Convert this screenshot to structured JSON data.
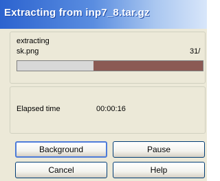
{
  "window": {
    "title": "Extracting from inp7_8.tar.gz"
  },
  "status": {
    "action": "extracting",
    "file": "sk.png",
    "counter": "31/",
    "progress_fraction": 0.41
  },
  "timing": {
    "elapsed_label": "Elapsed time",
    "elapsed_value": "00:00:16"
  },
  "buttons": {
    "background": "Background",
    "pause": "Pause",
    "cancel": "Cancel",
    "help": "Help"
  }
}
